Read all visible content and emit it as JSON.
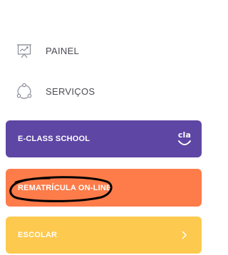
{
  "nav": {
    "items": [
      {
        "label": "PAINEL",
        "icon": "presentation-board-icon"
      },
      {
        "label": "SERVIÇOS",
        "icon": "cycle-nodes-icon"
      }
    ]
  },
  "cards": [
    {
      "label": "E-CLASS SCHOOL",
      "color": "#5e46a4",
      "icon": "cla-logo-icon",
      "logo_text": "cla"
    },
    {
      "label": "REMATRÍCULA ON-LINE",
      "color": "#fe7c4a",
      "annotation": "hand-drawn-oval-highlight"
    },
    {
      "label": "ESCOLAR",
      "color": "#fdc94e",
      "icon": "chevron-right-icon"
    }
  ],
  "colors": {
    "nav_text": "#4a4a55",
    "nav_icon": "#8a8d99",
    "annotation": "#000000"
  }
}
